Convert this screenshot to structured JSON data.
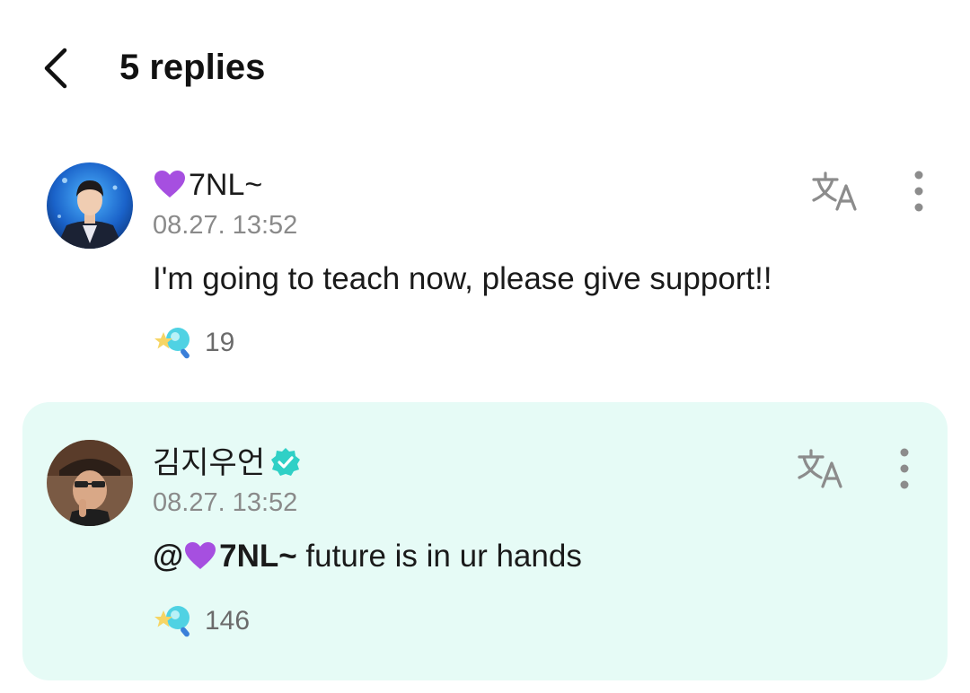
{
  "header": {
    "title": "5 replies"
  },
  "comments": [
    {
      "username": "7NL~",
      "timestamp": "08.27. 13:52",
      "text": "I'm going to teach now, please give support!!",
      "reaction_count": "19",
      "verified": false
    },
    {
      "username": "김지우언",
      "timestamp": "08.27. 13:52",
      "mention": "@",
      "mention_name": "7NL~",
      "text": " future is in ur hands",
      "reaction_count": "146",
      "verified": true
    }
  ],
  "icons": {
    "back": "chevron-left-icon",
    "translate": "translate-icon",
    "more": "more-vertical-icon",
    "heart": "purple-heart-icon",
    "verified": "verified-badge-icon",
    "reaction": "star-lightstick-icon"
  },
  "colors": {
    "highlight_bg": "#e6fbf6",
    "verified": "#2fd0c6",
    "heart": "#a64fe0",
    "timestamp": "#8a8a8a"
  }
}
